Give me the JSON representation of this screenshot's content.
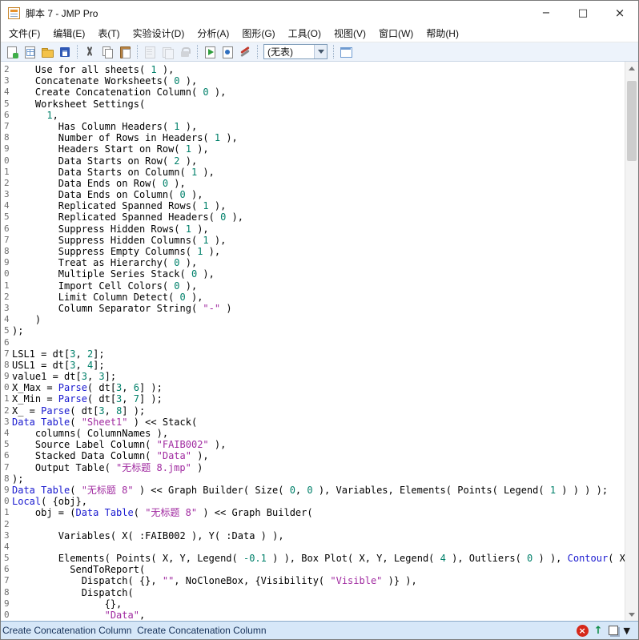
{
  "window": {
    "title": "脚本 7 - JMP Pro",
    "controls": {
      "minimize": "−",
      "maximize": "□",
      "close": "×"
    }
  },
  "menubar": {
    "items": [
      "文件(F)",
      "编辑(E)",
      "表(T)",
      "实验设计(D)",
      "分析(A)",
      "图形(G)",
      "工具(O)",
      "视图(V)",
      "窗口(W)",
      "帮助(H)"
    ]
  },
  "toolbar": {
    "groups": [
      {
        "icons": [
          {
            "name": "new-script-icon",
            "cls": "ic-newscript"
          },
          {
            "name": "new-data-table-icon",
            "cls": "ic-newtable"
          },
          {
            "name": "open-icon",
            "cls": "ic-open"
          },
          {
            "name": "save-icon",
            "cls": "ic-save"
          }
        ]
      },
      {
        "icons": [
          {
            "name": "cut-icon",
            "cls": "ic-cut"
          },
          {
            "name": "copy-icon",
            "cls": "ic-copy"
          },
          {
            "name": "paste-icon",
            "cls": "ic-paste"
          }
        ]
      },
      {
        "icons": [
          {
            "name": "print-icon",
            "cls": "ic-gray1",
            "disabled": true
          },
          {
            "name": "layout-icon",
            "cls": "ic-gray2",
            "disabled": true
          },
          {
            "name": "lock-icon",
            "cls": "ic-lock",
            "disabled": true
          }
        ]
      },
      {
        "icons": [
          {
            "name": "run-script-icon",
            "cls": "ic-run"
          },
          {
            "name": "debug-script-icon",
            "cls": "ic-debug"
          },
          {
            "name": "tools-icon",
            "cls": "ic-tools"
          }
        ]
      },
      {
        "combo": "(无表)"
      },
      {
        "icons": [
          {
            "name": "data-table-window-icon",
            "cls": "ic-tablewin"
          }
        ]
      }
    ]
  },
  "editor": {
    "lines": [
      {
        "n": "2",
        "s": [
          [
            "p",
            "    Use for all sheets( "
          ],
          [
            "n",
            "1"
          ],
          [
            "p",
            " ),"
          ]
        ]
      },
      {
        "n": "3",
        "s": [
          [
            "p",
            "    Concatenate Worksheets( "
          ],
          [
            "n",
            "0"
          ],
          [
            "p",
            " ),"
          ]
        ]
      },
      {
        "n": "4",
        "s": [
          [
            "p",
            "    Create Concatenation Column( "
          ],
          [
            "n",
            "0"
          ],
          [
            "p",
            " ),"
          ]
        ]
      },
      {
        "n": "5",
        "s": [
          [
            "p",
            "    Worksheet Settings("
          ]
        ]
      },
      {
        "n": "6",
        "s": [
          [
            "p",
            "      "
          ],
          [
            "n",
            "1"
          ],
          [
            "p",
            ","
          ]
        ]
      },
      {
        "n": "7",
        "s": [
          [
            "p",
            "        Has Column Headers( "
          ],
          [
            "n",
            "1"
          ],
          [
            "p",
            " ),"
          ]
        ]
      },
      {
        "n": "8",
        "s": [
          [
            "p",
            "        Number of Rows in Headers( "
          ],
          [
            "n",
            "1"
          ],
          [
            "p",
            " ),"
          ]
        ]
      },
      {
        "n": "9",
        "s": [
          [
            "p",
            "        Headers Start on Row( "
          ],
          [
            "n",
            "1"
          ],
          [
            "p",
            " ),"
          ]
        ]
      },
      {
        "n": "0",
        "s": [
          [
            "p",
            "        Data Starts on Row( "
          ],
          [
            "n",
            "2"
          ],
          [
            "p",
            " ),"
          ]
        ]
      },
      {
        "n": "1",
        "s": [
          [
            "p",
            "        Data Starts on Column( "
          ],
          [
            "n",
            "1"
          ],
          [
            "p",
            " ),"
          ]
        ]
      },
      {
        "n": "2",
        "s": [
          [
            "p",
            "        Data Ends on Row( "
          ],
          [
            "n",
            "0"
          ],
          [
            "p",
            " ),"
          ]
        ]
      },
      {
        "n": "3",
        "s": [
          [
            "p",
            "        Data Ends on Column( "
          ],
          [
            "n",
            "0"
          ],
          [
            "p",
            " ),"
          ]
        ]
      },
      {
        "n": "4",
        "s": [
          [
            "p",
            "        Replicated Spanned Rows( "
          ],
          [
            "n",
            "1"
          ],
          [
            "p",
            " ),"
          ]
        ]
      },
      {
        "n": "5",
        "s": [
          [
            "p",
            "        Replicated Spanned Headers( "
          ],
          [
            "n",
            "0"
          ],
          [
            "p",
            " ),"
          ]
        ]
      },
      {
        "n": "6",
        "s": [
          [
            "p",
            "        Suppress Hidden Rows( "
          ],
          [
            "n",
            "1"
          ],
          [
            "p",
            " ),"
          ]
        ]
      },
      {
        "n": "7",
        "s": [
          [
            "p",
            "        Suppress Hidden Columns( "
          ],
          [
            "n",
            "1"
          ],
          [
            "p",
            " ),"
          ]
        ]
      },
      {
        "n": "8",
        "s": [
          [
            "p",
            "        Suppress Empty Columns( "
          ],
          [
            "n",
            "1"
          ],
          [
            "p",
            " ),"
          ]
        ]
      },
      {
        "n": "9",
        "s": [
          [
            "p",
            "        Treat as Hierarchy( "
          ],
          [
            "n",
            "0"
          ],
          [
            "p",
            " ),"
          ]
        ]
      },
      {
        "n": "0",
        "s": [
          [
            "p",
            "        Multiple Series Stack( "
          ],
          [
            "n",
            "0"
          ],
          [
            "p",
            " ),"
          ]
        ]
      },
      {
        "n": "1",
        "s": [
          [
            "p",
            "        Import Cell Colors( "
          ],
          [
            "n",
            "0"
          ],
          [
            "p",
            " ),"
          ]
        ]
      },
      {
        "n": "2",
        "s": [
          [
            "p",
            "        Limit Column Detect( "
          ],
          [
            "n",
            "0"
          ],
          [
            "p",
            " ),"
          ]
        ]
      },
      {
        "n": "3",
        "s": [
          [
            "p",
            "        Column Separator String( "
          ],
          [
            "s",
            "\"-\""
          ],
          [
            "p",
            " )"
          ]
        ]
      },
      {
        "n": "4",
        "s": [
          [
            "p",
            "    )"
          ]
        ]
      },
      {
        "n": "5",
        "s": [
          [
            "p",
            ");"
          ]
        ]
      },
      {
        "n": "6",
        "s": []
      },
      {
        "n": "7",
        "s": [
          [
            "p",
            "LSL1 = dt["
          ],
          [
            "n",
            "3"
          ],
          [
            "p",
            ", "
          ],
          [
            "n",
            "2"
          ],
          [
            "p",
            "];"
          ]
        ]
      },
      {
        "n": "8",
        "s": [
          [
            "p",
            "USL1 = dt["
          ],
          [
            "n",
            "3"
          ],
          [
            "p",
            ", "
          ],
          [
            "n",
            "4"
          ],
          [
            "p",
            "];"
          ]
        ]
      },
      {
        "n": "9",
        "s": [
          [
            "p",
            "value1 = dt["
          ],
          [
            "n",
            "3"
          ],
          [
            "p",
            ", "
          ],
          [
            "n",
            "3"
          ],
          [
            "p",
            "];"
          ]
        ]
      },
      {
        "n": "0",
        "s": [
          [
            "p",
            "X_Max = "
          ],
          [
            "k",
            "Parse"
          ],
          [
            "p",
            "( dt["
          ],
          [
            "n",
            "3"
          ],
          [
            "p",
            ", "
          ],
          [
            "n",
            "6"
          ],
          [
            "p",
            "] );"
          ]
        ]
      },
      {
        "n": "1",
        "s": [
          [
            "p",
            "X_Min = "
          ],
          [
            "k",
            "Parse"
          ],
          [
            "p",
            "( dt["
          ],
          [
            "n",
            "3"
          ],
          [
            "p",
            ", "
          ],
          [
            "n",
            "7"
          ],
          [
            "p",
            "] );"
          ]
        ]
      },
      {
        "n": "2",
        "s": [
          [
            "p",
            "X_ = "
          ],
          [
            "k",
            "Parse"
          ],
          [
            "p",
            "( dt["
          ],
          [
            "n",
            "3"
          ],
          [
            "p",
            ", "
          ],
          [
            "n",
            "8"
          ],
          [
            "p",
            "] );"
          ]
        ]
      },
      {
        "n": "3",
        "s": [
          [
            "k",
            "Data Table"
          ],
          [
            "p",
            "( "
          ],
          [
            "s",
            "\"Sheet1\""
          ],
          [
            "p",
            " ) << Stack("
          ]
        ]
      },
      {
        "n": "4",
        "s": [
          [
            "p",
            "    columns( ColumnNames ),"
          ]
        ]
      },
      {
        "n": "5",
        "s": [
          [
            "p",
            "    Source Label Column( "
          ],
          [
            "s",
            "\"FAIB002\""
          ],
          [
            "p",
            " ),"
          ]
        ]
      },
      {
        "n": "6",
        "s": [
          [
            "p",
            "    Stacked Data Column( "
          ],
          [
            "s",
            "\"Data\""
          ],
          [
            "p",
            " ),"
          ]
        ]
      },
      {
        "n": "7",
        "s": [
          [
            "p",
            "    Output Table( "
          ],
          [
            "s",
            "\"无标题 8.jmp\""
          ],
          [
            "p",
            " )"
          ]
        ]
      },
      {
        "n": "8",
        "s": [
          [
            "p",
            ");"
          ]
        ]
      },
      {
        "n": "9",
        "s": [
          [
            "k",
            "Data Table"
          ],
          [
            "p",
            "( "
          ],
          [
            "s",
            "\"无标题 8\""
          ],
          [
            "p",
            " ) << Graph Builder( Size( "
          ],
          [
            "n",
            "0"
          ],
          [
            "p",
            ", "
          ],
          [
            "n",
            "0"
          ],
          [
            "p",
            " ), Variables, Elements( Points( Legend( "
          ],
          [
            "n",
            "1"
          ],
          [
            "p",
            " ) ) ) );"
          ]
        ]
      },
      {
        "n": "0",
        "s": [
          [
            "k",
            "Local"
          ],
          [
            "p",
            "( {obj},"
          ]
        ]
      },
      {
        "n": "1",
        "s": [
          [
            "p",
            "    obj = ("
          ],
          [
            "k",
            "Data Table"
          ],
          [
            "p",
            "( "
          ],
          [
            "s",
            "\"无标题 8\""
          ],
          [
            "p",
            " ) << Graph Builder("
          ]
        ]
      },
      {
        "n": "2",
        "s": []
      },
      {
        "n": "3",
        "s": [
          [
            "p",
            "        Variables( X( :FAIB002 ), Y( :Data ) ),"
          ]
        ]
      },
      {
        "n": "4",
        "s": []
      },
      {
        "n": "5",
        "s": [
          [
            "p",
            "        Elements( Points( X, Y, Legend( "
          ],
          [
            "n",
            "-0.1"
          ],
          [
            "p",
            " ) ), Box Plot( X, Y, Legend( "
          ],
          [
            "n",
            "4"
          ],
          [
            "p",
            " ), Outliers( "
          ],
          [
            "n",
            "0"
          ],
          [
            "p",
            " ) ), "
          ],
          [
            "k",
            "Contour"
          ],
          [
            "p",
            "( X, Y, Le"
          ]
        ]
      },
      {
        "n": "6",
        "s": [
          [
            "p",
            "          SendToReport("
          ]
        ]
      },
      {
        "n": "7",
        "s": [
          [
            "p",
            "            Dispatch( {}, "
          ],
          [
            "s",
            "\"\""
          ],
          [
            "p",
            ", NoCloneBox, {Visibility( "
          ],
          [
            "s",
            "\"Visible\""
          ],
          [
            "p",
            " )} ),"
          ]
        ]
      },
      {
        "n": "8",
        "s": [
          [
            "p",
            "            Dispatch("
          ]
        ]
      },
      {
        "n": "9",
        "s": [
          [
            "p",
            "                {},"
          ]
        ]
      },
      {
        "n": "0",
        "s": [
          [
            "p",
            "                "
          ],
          [
            "s",
            "\"Data\""
          ],
          [
            "p",
            ","
          ]
        ]
      }
    ]
  },
  "statusbar": {
    "message": "Create Concatenation Column  Create Concatenation Column",
    "icons": [
      {
        "name": "error-log-icon",
        "cls": "sic-err",
        "glyph": "×"
      },
      {
        "name": "scroll-to-top-icon",
        "cls": "sic-up",
        "glyph": "↑"
      },
      {
        "name": "window-icon",
        "cls": "sic-win"
      },
      {
        "name": "more-options-icon",
        "cls": "sic-dd",
        "glyph": "▼"
      }
    ]
  },
  "colors": {
    "keyword": "#1818cf",
    "string": "#a02aa0",
    "number": "#00806a",
    "toolbar_bg": "#edf3fb",
    "status_bg": "#d6e7f8"
  }
}
